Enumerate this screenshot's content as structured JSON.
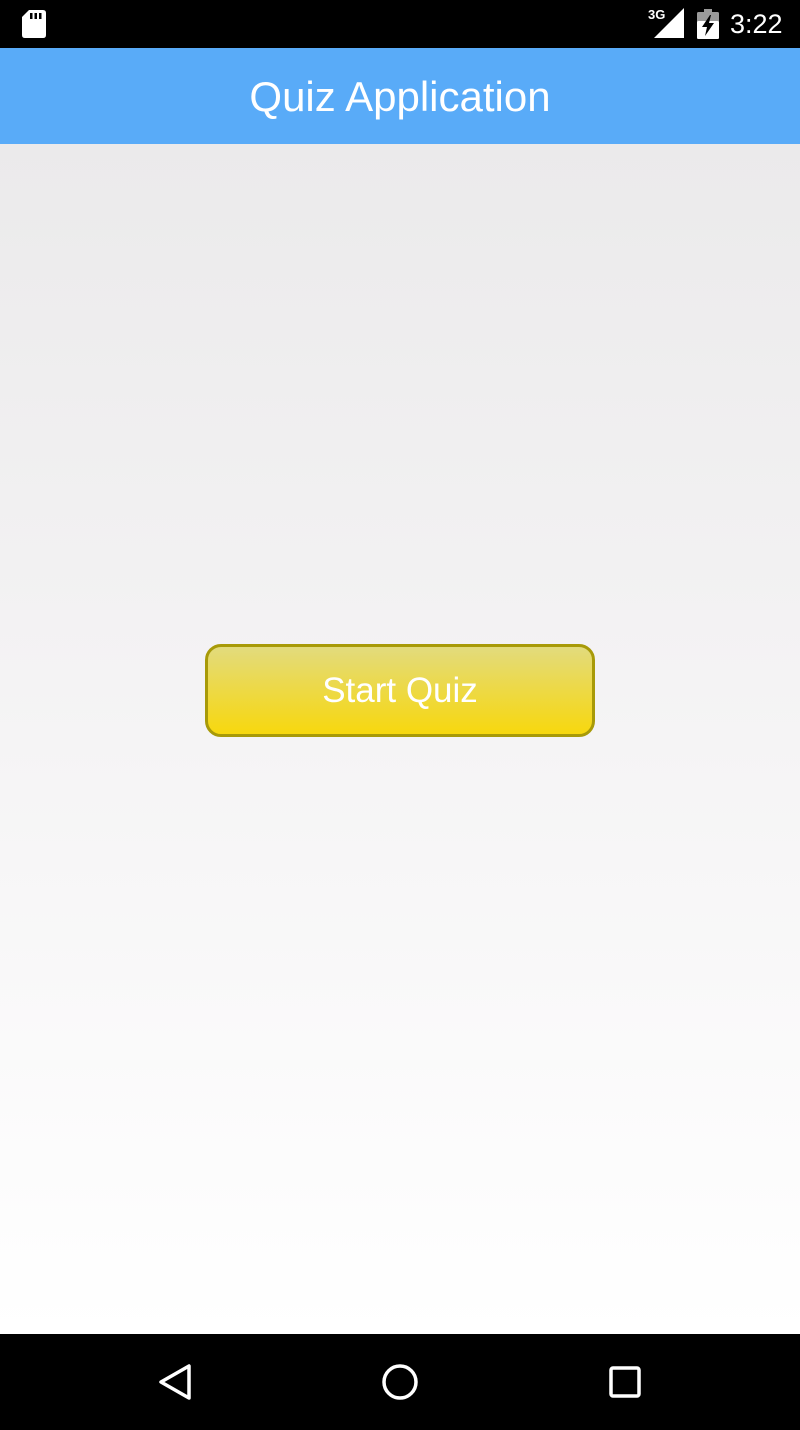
{
  "status_bar": {
    "network": "3G",
    "time": "3:22",
    "icons": [
      "sd-card-icon",
      "signal-icon",
      "battery-charging-icon"
    ]
  },
  "app_bar": {
    "title": "Quiz Application",
    "color": "#59abf8"
  },
  "main": {
    "start_button_label": "Start Quiz",
    "button_colors": {
      "top": "#e2db7d",
      "bottom": "#f7d80e",
      "border": "#a89a08"
    }
  },
  "nav_bar": {
    "icons": [
      "back-icon",
      "home-icon",
      "recents-icon"
    ]
  }
}
